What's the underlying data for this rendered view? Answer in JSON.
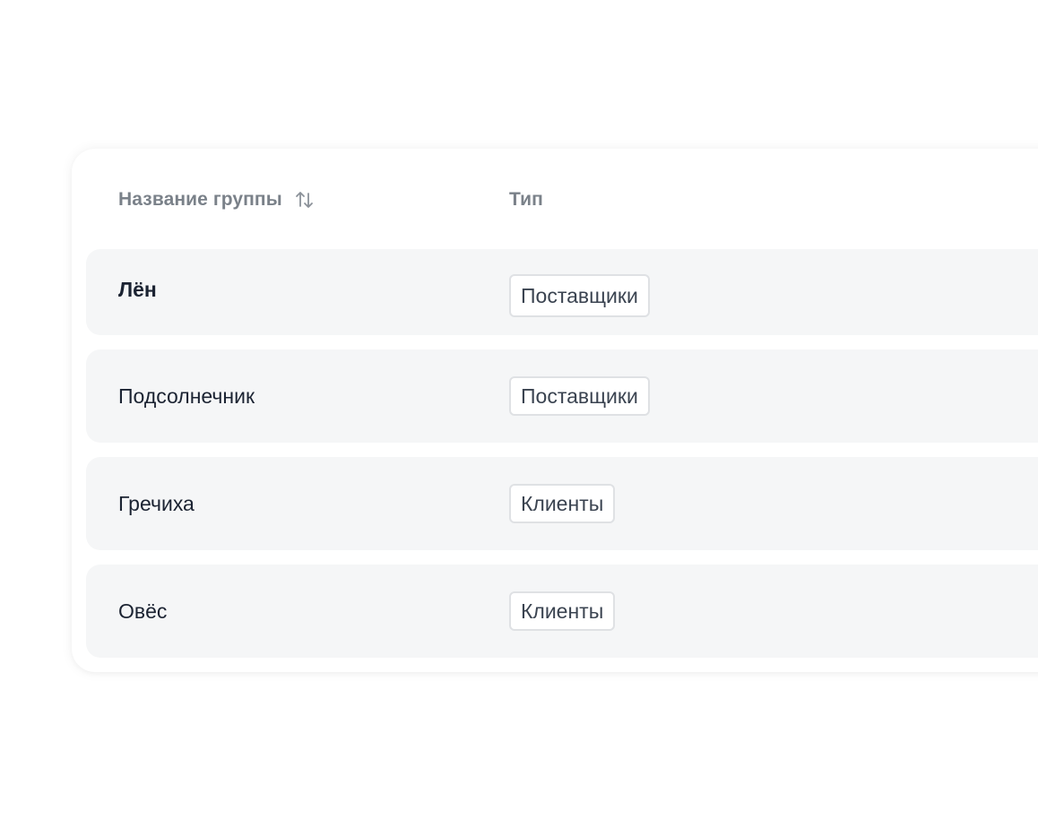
{
  "table": {
    "columns": {
      "name_label": "Название группы",
      "type_label": "Тип",
      "sort_icon": "sort-up-down-icon"
    },
    "rows": [
      {
        "name": "Лён",
        "type": "Поставщики"
      },
      {
        "name": "Подсолнечник",
        "type": "Поставщики"
      },
      {
        "name": "Гречиха",
        "type": "Клиенты"
      },
      {
        "name": "Овёс",
        "type": "Клиенты"
      }
    ]
  },
  "colors": {
    "row_background": "#f5f6f7",
    "header_text": "#7a8189",
    "body_text": "#1b2332",
    "badge_border": "#dfe1e4"
  }
}
